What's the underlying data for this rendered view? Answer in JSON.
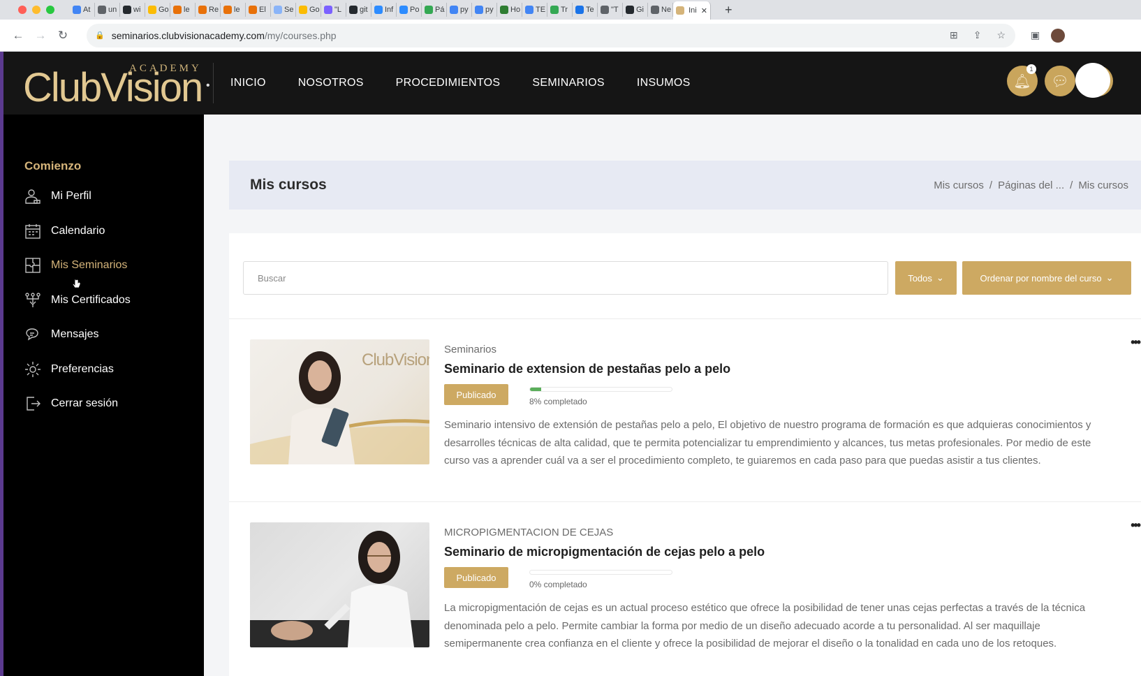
{
  "browser": {
    "tabs": [
      "At",
      "un",
      "wi",
      "Go",
      "le",
      "Re",
      "le",
      "El",
      "Se",
      "Go",
      "\"L",
      "git",
      "Inf",
      "Po",
      "Pá",
      "py",
      "py",
      "Ho",
      "TE",
      "Tr",
      "Te",
      "\"T",
      "Gi",
      "Ne",
      "Ini"
    ],
    "tab_colors": [
      "#4285f4",
      "#5f6368",
      "#24292e",
      "#fbbc04",
      "#e8710a",
      "#e8710a",
      "#e8710a",
      "#e8710a",
      "#8ab4f8",
      "#fbbc04",
      "#7b61ff",
      "#24292e",
      "#2d8cff",
      "#2d8cff",
      "#34a853",
      "#4285f4",
      "#4285f4",
      "#2e7d32",
      "#4285f4",
      "#34a853",
      "#1a73e8",
      "#5f6368",
      "#24292e",
      "#5f6368",
      "#d5b47a"
    ],
    "url_domain": "seminarios.clubvisionacademy.com",
    "url_path": "/my/courses.php"
  },
  "header": {
    "logo_academy": "ACADEMY",
    "logo_brand": "ClubVision",
    "nav": [
      "INICIO",
      "NOSOTROS",
      "PROCEDIMIENTOS",
      "SEMINARIOS",
      "INSUMOS"
    ],
    "notification_count": "1",
    "accent_color": "#c9a55c"
  },
  "sidebar": {
    "title": "Comienzo",
    "items": [
      {
        "label": "Mi Perfil",
        "icon": "user-profile-icon"
      },
      {
        "label": "Calendario",
        "icon": "calendar-icon"
      },
      {
        "label": "Mis Seminarios",
        "icon": "puzzle-icon"
      },
      {
        "label": "Mis Certificados",
        "icon": "certificate-icon"
      },
      {
        "label": "Mensajes",
        "icon": "chat-icon"
      },
      {
        "label": "Preferencias",
        "icon": "gear-icon"
      },
      {
        "label": "Cerrar sesión",
        "icon": "logout-icon"
      }
    ]
  },
  "page": {
    "title": "Mis cursos",
    "breadcrumb": [
      "Mis cursos",
      "/",
      "Páginas del ...",
      "/",
      "Mis cursos"
    ]
  },
  "filters": {
    "search_placeholder": "Buscar",
    "status_filter": "Todos",
    "sort": "Ordenar por nombre del curso"
  },
  "courses": [
    {
      "category": "Seminarios",
      "title": "Seminario de extension de pestañas pelo a pelo",
      "status": "Publicado",
      "progress": 8,
      "progress_text": "8% completado",
      "thumb_brand": "ClubVision",
      "description": "Seminario intensivo de extensión de pestañas pelo a pelo, El objetivo de nuestro programa de formación es que adquieras conocimientos y desarrolles técnicas de alta calidad, que te permita potencializar tu emprendimiento y alcances, tus metas profesionales. Por medio de este curso vas a aprender cuál va a ser el procedimiento completo, te guiaremos en cada paso para que puedas asistir a tus clientes."
    },
    {
      "category": "MICROPIGMENTACION DE CEJAS",
      "title": "Seminario de micropigmentación de cejas pelo a pelo",
      "status": "Publicado",
      "progress": 0,
      "progress_text": "0% completado",
      "description": "La micropigmentación de cejas es un actual proceso estético que ofrece la posibilidad de tener unas cejas perfectas a través de la técnica denominada pelo a pelo. Permite cambiar la forma por medio de un diseño adecuado acorde a tu personalidad. Al ser maquillaje semipermanente crea confianza en el cliente y ofrece la posibilidad de mejorar el diseño o la tonalidad en cada uno de los retoques."
    }
  ]
}
